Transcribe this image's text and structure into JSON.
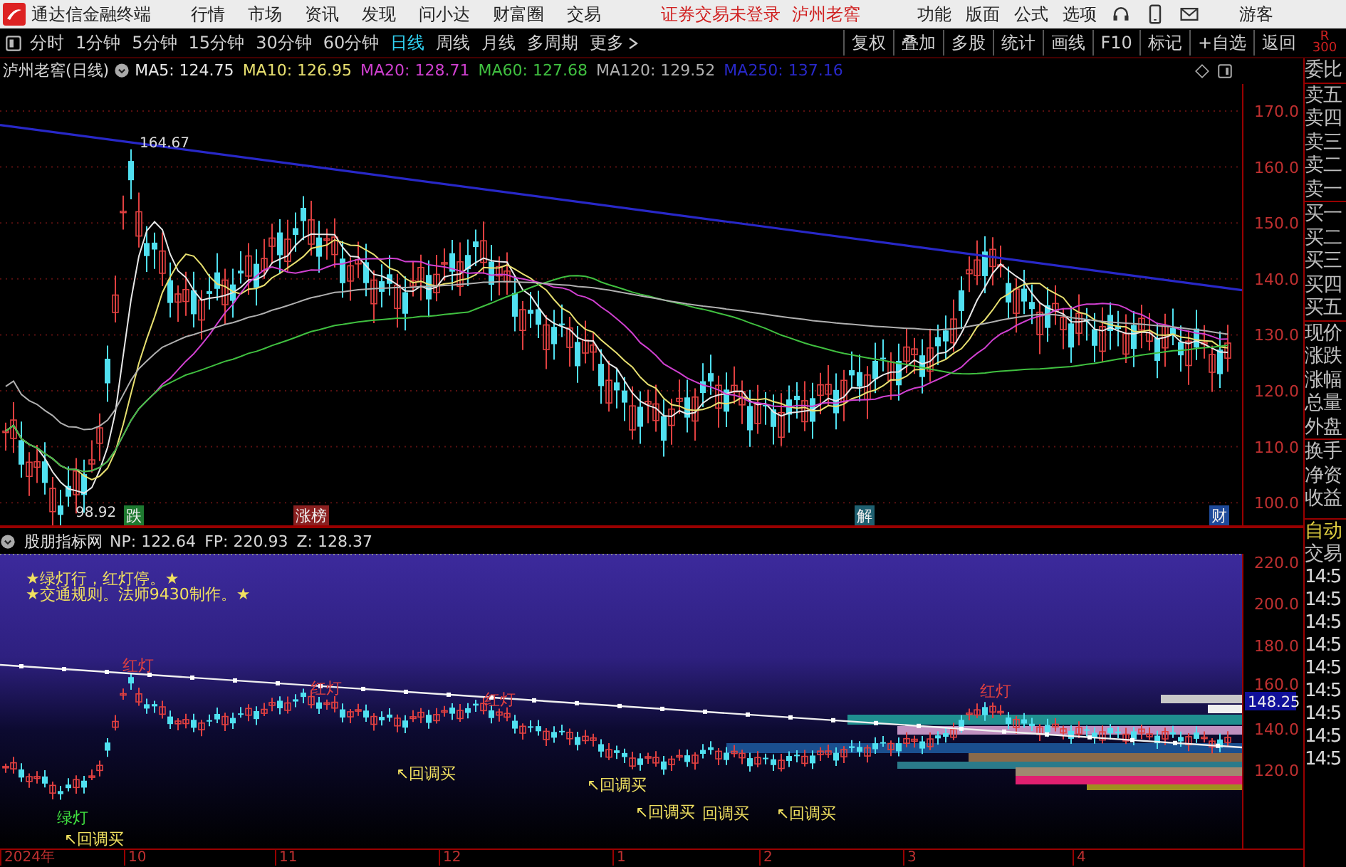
{
  "app_bar": {
    "title": "通达信金融终端",
    "menu": [
      "行情",
      "市场",
      "资讯",
      "发现",
      "问小达",
      "财富圈",
      "交易"
    ],
    "login_status": "证券交易未登录",
    "stock_name": "泸州老窖",
    "tools": [
      "功能",
      "版面",
      "公式",
      "选项"
    ],
    "user": "游客"
  },
  "period_tabs": [
    {
      "label": "分时",
      "selected": false
    },
    {
      "label": "1分钟",
      "selected": false
    },
    {
      "label": "5分钟",
      "selected": false
    },
    {
      "label": "15分钟",
      "selected": false
    },
    {
      "label": "30分钟",
      "selected": false
    },
    {
      "label": "60分钟",
      "selected": false
    },
    {
      "label": "日线",
      "selected": true
    },
    {
      "label": "周线",
      "selected": false
    },
    {
      "label": "月线",
      "selected": false
    },
    {
      "label": "多周期",
      "selected": false
    },
    {
      "label": "更多",
      "selected": false
    }
  ],
  "chart_tools": [
    "复权",
    "叠加",
    "多股",
    "统计",
    "画线",
    "F10",
    "标记",
    "+自选",
    "返回"
  ],
  "main_chart": {
    "title": "泸州老窖(日线)",
    "ma_legend": [
      {
        "label": "MA5: 124.75",
        "color": "#e8e8e8"
      },
      {
        "label": "MA10: 126.95",
        "color": "#e8e070"
      },
      {
        "label": "MA20: 128.71",
        "color": "#d040d0"
      },
      {
        "label": "MA60: 127.68",
        "color": "#40c040"
      },
      {
        "label": "MA120: 129.52",
        "color": "#b0b0b0"
      },
      {
        "label": "MA250: 137.16",
        "color": "#2828c8"
      }
    ],
    "y_labels": [
      "170.0",
      "160.0",
      "150.0",
      "140.0",
      "130.0",
      "120.0",
      "110.0",
      "100.0"
    ],
    "high_label": "164.67",
    "low_label": "98.92",
    "event_tags": [
      {
        "label": "跌",
        "color": "#1e7a30"
      },
      {
        "label": "涨榜",
        "color": "#8a2020"
      },
      {
        "label": "解",
        "color": "#1f6070"
      },
      {
        "label": "财",
        "color": "#1e4a9a"
      }
    ]
  },
  "indicator": {
    "name": "股朋指标网",
    "values": [
      "NP: 122.64",
      "FP: 220.93",
      "Z: 128.37"
    ],
    "notes": [
      "★绿灯行，红灯停。★",
      "★交通规则。法师9430制作。★"
    ],
    "y_labels": [
      "220.0",
      "200.0",
      "180.0",
      "160.0",
      "140.0",
      "120.0"
    ],
    "current_value": "148.25",
    "signals": [
      {
        "kind": "green",
        "label": "绿灯"
      },
      {
        "kind": "buy",
        "label": "↖回调买"
      },
      {
        "kind": "red",
        "label": "红灯"
      },
      {
        "kind": "red",
        "label": "红灯"
      },
      {
        "kind": "buy",
        "label": "↖回调买"
      },
      {
        "kind": "red",
        "label": "红灯"
      },
      {
        "kind": "buy",
        "label": "↖回调买"
      },
      {
        "kind": "buy",
        "label": "↖回调买"
      },
      {
        "kind": "buy",
        "label": "回调买"
      },
      {
        "kind": "buy",
        "label": "↖回调买"
      },
      {
        "kind": "red",
        "label": "红灯"
      }
    ]
  },
  "x_labels": [
    "2024年",
    "10",
    "11",
    "12",
    "1",
    "2",
    "3",
    "4"
  ],
  "quote_panel": {
    "badge": "R",
    "badge_sub": "300",
    "labels": [
      "委比",
      "卖五",
      "卖四",
      "卖三",
      "卖二",
      "卖一",
      "买一",
      "买二",
      "买三",
      "买四",
      "买五",
      "现价",
      "涨跌",
      "涨幅",
      "总量",
      "外盘",
      "换手",
      "净资",
      "收益"
    ],
    "trade_labels": [
      {
        "label": "自动",
        "kind": "highlight"
      },
      {
        "label": "交易",
        "kind": "plain"
      }
    ],
    "times": [
      "14:5",
      "14:5",
      "14:5",
      "14:5",
      "14:5",
      "14:5",
      "14:5",
      "14:5",
      "14:5"
    ]
  }
}
